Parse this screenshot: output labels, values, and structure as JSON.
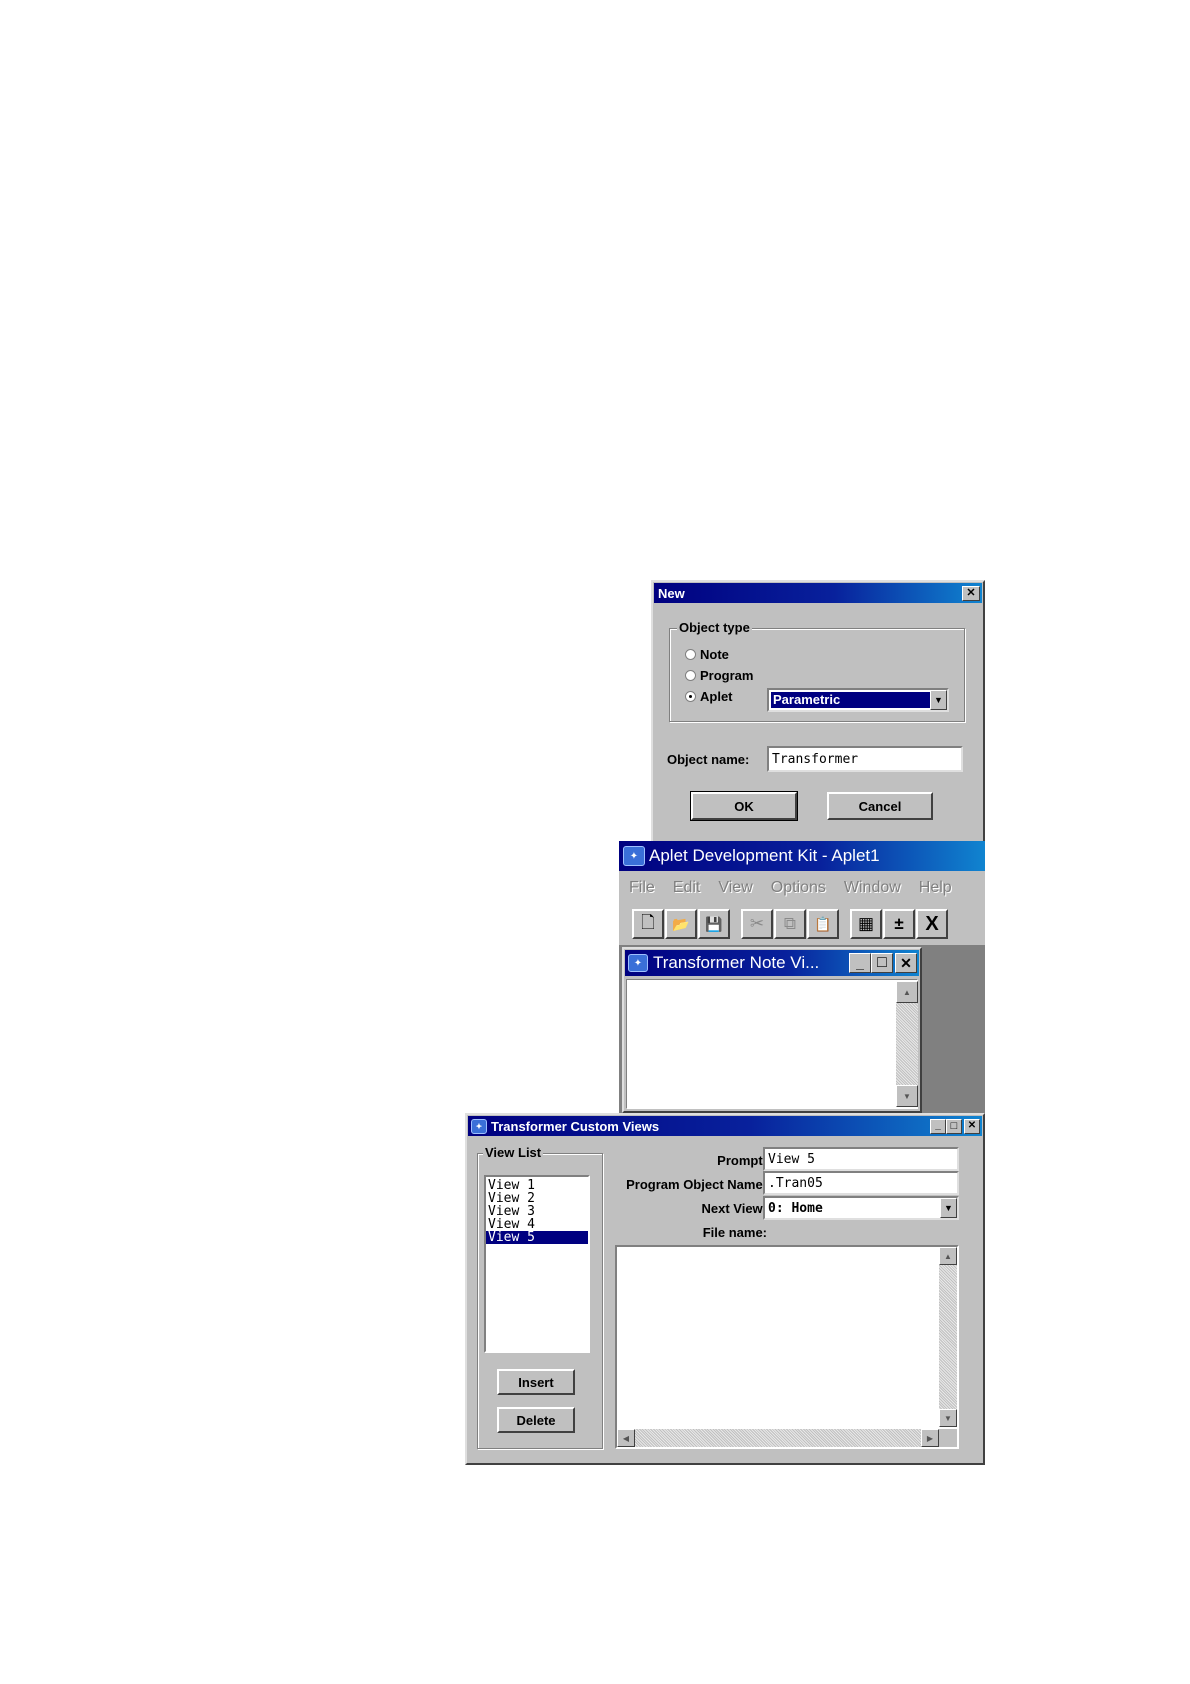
{
  "new_dialog": {
    "title": "New",
    "close_glyph": "✕",
    "group_label": "Object type",
    "options": [
      {
        "label": "Note",
        "selected": false
      },
      {
        "label": "Program",
        "selected": false
      },
      {
        "label": "Aplet",
        "selected": true
      }
    ],
    "aplet_type_value": "Parametric",
    "dropdown_glyph": "▼",
    "object_name_label": "Object name:",
    "object_name_value": "Transformer",
    "ok_label": "OK",
    "cancel_label": "Cancel"
  },
  "adk_window": {
    "title": "Aplet Development Kit - Aplet1",
    "menu": [
      "File",
      "Edit",
      "View",
      "Options",
      "Window",
      "Help"
    ],
    "toolbar_glyphs": {
      "new": "🗋",
      "open": "📂",
      "save": "💾",
      "cut": "✂",
      "copy": "⧉",
      "paste": "📋",
      "grid": "▦",
      "calc": "±",
      "close": "X"
    },
    "child_title": "Transformer Note Vi...",
    "child_buttons": {
      "minimize": "_",
      "maximize": "□",
      "close": "✕"
    },
    "scroll_up": "▲",
    "scroll_down": "▼"
  },
  "custom_views": {
    "title": "Transformer Custom Views",
    "window_buttons": {
      "minimize": "_",
      "maximize": "□",
      "close": "✕"
    },
    "view_list_label": "View List",
    "views": [
      "View 1",
      "View 2",
      "View 3",
      "View 4",
      "View 5"
    ],
    "selected_index": 4,
    "insert_label": "Insert",
    "delete_label": "Delete",
    "prompt_label": "Prompt:",
    "prompt_value": "View 5",
    "program_object_label": "Program Object Name:",
    "program_object_value": ".Tran05",
    "next_view_label": "Next View:",
    "next_view_value": "0: Home",
    "dropdown_glyph": "▼",
    "file_name_label": "File name:",
    "scroll_up": "▲",
    "scroll_down": "▼",
    "scroll_left": "◀",
    "scroll_right": "▶"
  }
}
